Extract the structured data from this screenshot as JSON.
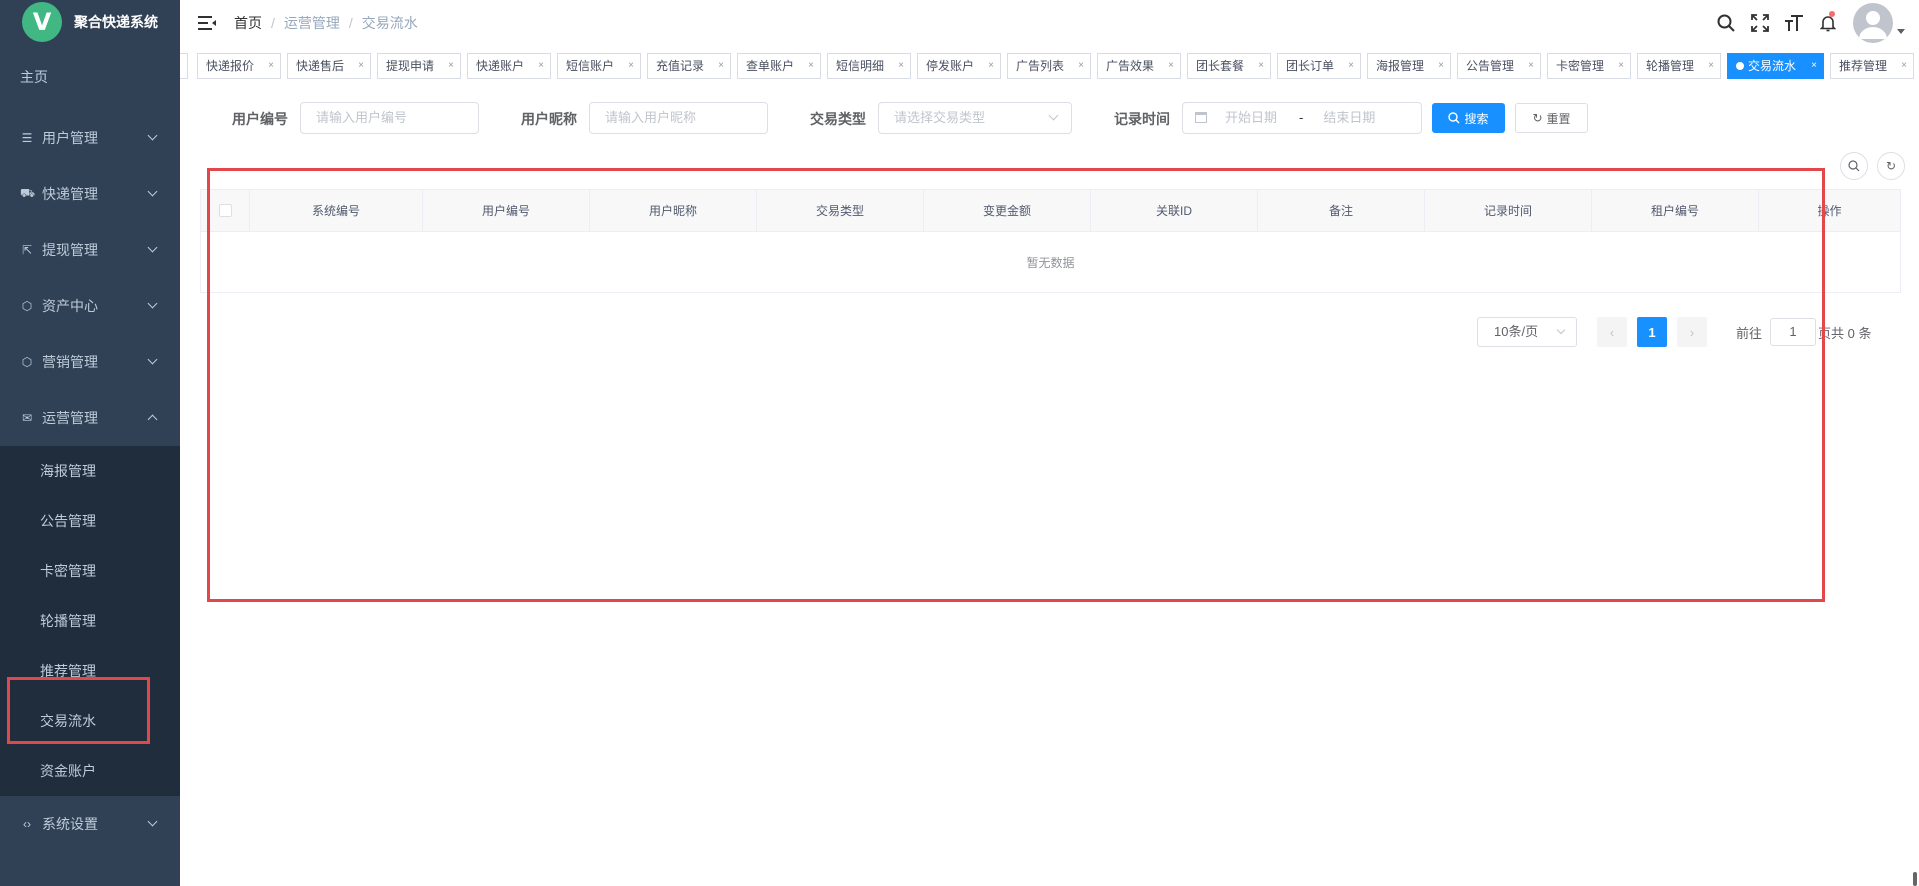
{
  "app": {
    "logo_letter": "V",
    "title": "聚合快递系统"
  },
  "sidebar": {
    "home": "主页",
    "groups": [
      {
        "label": "用户管理",
        "icon": "database-icon"
      },
      {
        "label": "快递管理",
        "icon": "truck-icon"
      },
      {
        "label": "提现管理",
        "icon": "withdraw-icon"
      },
      {
        "label": "资产中心",
        "icon": "cube-icon"
      },
      {
        "label": "营销管理",
        "icon": "cube-icon"
      },
      {
        "label": "运营管理",
        "icon": "mail-icon"
      }
    ],
    "sub": [
      "海报管理",
      "公告管理",
      "卡密管理",
      "轮播管理",
      "推荐管理",
      "交易流水",
      "资金账户"
    ],
    "settings": "系统设置"
  },
  "breadcrumb": {
    "home": "首页",
    "section": "运营管理",
    "page": "交易流水",
    "sep": "/"
  },
  "tags": [
    {
      "label": "快递报价"
    },
    {
      "label": "快递售后"
    },
    {
      "label": "提现申请"
    },
    {
      "label": "快递账户"
    },
    {
      "label": "短信账户"
    },
    {
      "label": "充值记录"
    },
    {
      "label": "查单账户"
    },
    {
      "label": "短信明细"
    },
    {
      "label": "停发账户"
    },
    {
      "label": "广告列表"
    },
    {
      "label": "广告效果"
    },
    {
      "label": "团长套餐"
    },
    {
      "label": "团长订单"
    },
    {
      "label": "海报管理"
    },
    {
      "label": "公告管理"
    },
    {
      "label": "卡密管理"
    },
    {
      "label": "轮播管理"
    },
    {
      "label": "交易流水"
    },
    {
      "label": "推荐管理"
    }
  ],
  "tag_close": "×",
  "active_tag": "交易流水",
  "search": {
    "user_id_label": "用户编号",
    "user_id_placeholder": "请输入用户编号",
    "nickname_label": "用户昵称",
    "nickname_placeholder": "请输入用户昵称",
    "type_label": "交易类型",
    "type_placeholder": "请选择交易类型",
    "time_label": "记录时间",
    "start_placeholder": "开始日期",
    "range_sep": "-",
    "end_placeholder": "结束日期",
    "search_btn": "搜索",
    "reset_btn": "重置"
  },
  "table": {
    "columns": [
      "系统编号",
      "用户编号",
      "用户昵称",
      "交易类型",
      "变更金额",
      "关联ID",
      "备注",
      "记录时间",
      "租户编号",
      "操作"
    ],
    "empty_text": "暂无数据"
  },
  "pagination": {
    "page_size": "10条/页",
    "current_page": "1",
    "goto_label": "前往",
    "goto_value": "1",
    "goto_suffix": "页",
    "total": "共 0 条"
  },
  "colors": {
    "sidebar_bg": "#304156",
    "primary": "#1890ff",
    "highlight": "#e2474b",
    "logo": "#41b883"
  }
}
